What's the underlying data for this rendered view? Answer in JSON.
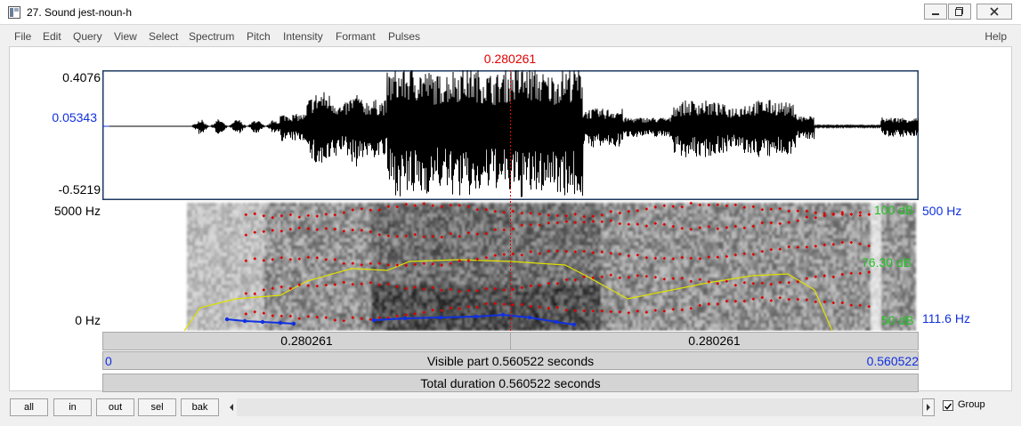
{
  "window": {
    "title": "27. Sound jest-noun-h",
    "icon": "praat-sound-icon"
  },
  "menu": {
    "items": [
      "File",
      "Edit",
      "Query",
      "View",
      "Select",
      "Spectrum",
      "Pitch",
      "Intensity",
      "Formant",
      "Pulses"
    ],
    "help": "Help"
  },
  "cursor": {
    "time_label": "0.280261",
    "time": 0.280261
  },
  "waveform": {
    "max_label": "0.4076",
    "cursor_value_label": "0.05343",
    "min_label": "-0.5219",
    "max": 0.4076,
    "min": -0.5219
  },
  "spectrogram": {
    "freq_top_label": "5000 Hz",
    "freq_bottom_label": "0 Hz",
    "intensity_top_label": "100 dB",
    "intensity_cursor_label": "76.30 dB",
    "intensity_bottom_label": "50 dB",
    "pitch_top_label": "500 Hz",
    "pitch_bottom_label": "111.6 Hz",
    "colors": {
      "formant": "#e00000",
      "intensity": "#e0e000",
      "pitch": "#1030e0",
      "cursor": "#e00000"
    }
  },
  "time_bars": {
    "left_segment": "0.280261",
    "right_segment": "0.280261",
    "visible_start": "0",
    "visible_label": "Visible part 0.560522 seconds",
    "visible_end": "0.560522",
    "total_label": "Total duration 0.560522 seconds"
  },
  "bottom": {
    "buttons": [
      "all",
      "in",
      "out",
      "sel",
      "bak"
    ],
    "group_label": "Group",
    "group_checked": true
  }
}
